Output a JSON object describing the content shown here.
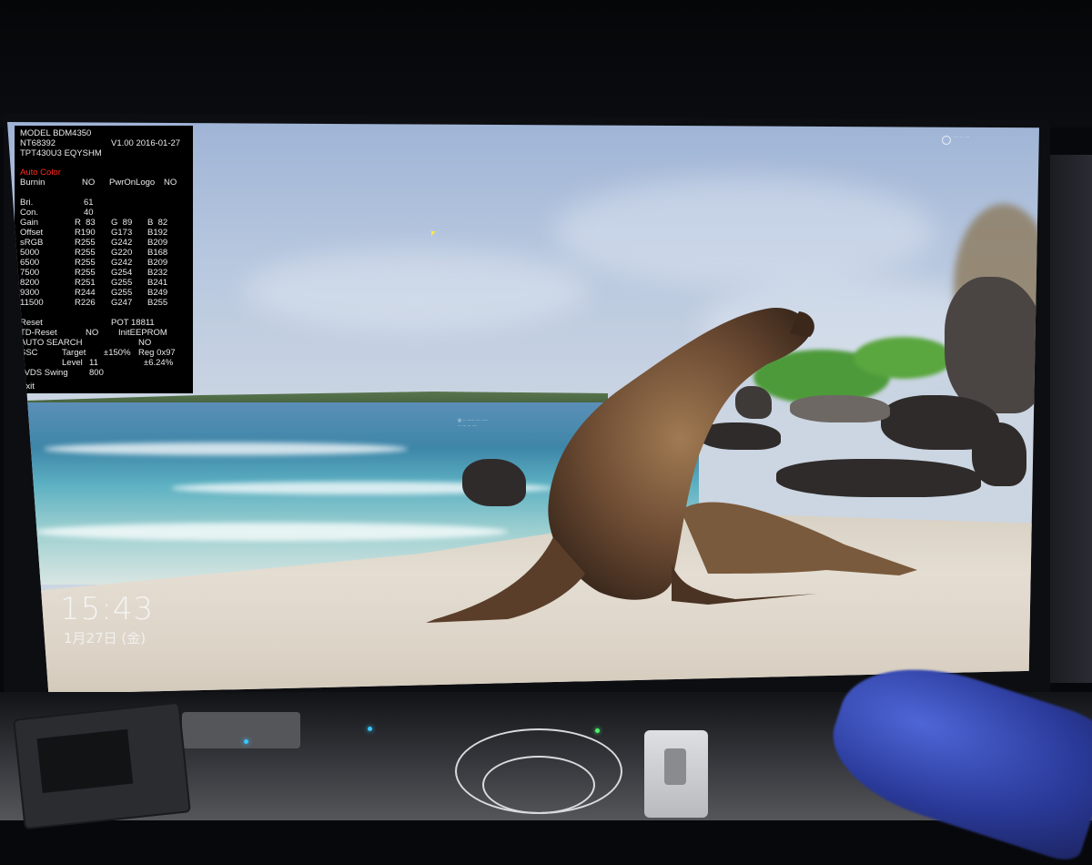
{
  "osd": {
    "model": "MODEL BDM4350",
    "chip": "NT68392",
    "version": "V1.00 2016-01-27",
    "panel": "TPT430U3 EQYSHM",
    "auto_color": "Auto Color",
    "burnin_label": "Burnin",
    "burnin_value": "NO",
    "pwr_label": "PwrOnLogo",
    "pwr_value": "NO",
    "bri_label": "Bri.",
    "bri_value": "61",
    "con_label": "Con.",
    "con_value": "40",
    "table": [
      {
        "label": "Gain",
        "r": "R  83",
        "g": "G  89",
        "b": "B  82"
      },
      {
        "label": "Offset",
        "r": "R190",
        "g": "G173",
        "b": "B192"
      },
      {
        "label": "sRGB",
        "r": "R255",
        "g": "G242",
        "b": "B209"
      },
      {
        "label": "5000",
        "r": "R255",
        "g": "G220",
        "b": "B168"
      },
      {
        "label": "6500",
        "r": "R255",
        "g": "G242",
        "b": "B209"
      },
      {
        "label": "7500",
        "r": "R255",
        "g": "G254",
        "b": "B232"
      },
      {
        "label": "8200",
        "r": "R251",
        "g": "G255",
        "b": "B241"
      },
      {
        "label": "9300",
        "r": "R244",
        "g": "G255",
        "b": "B249"
      },
      {
        "label": "11500",
        "r": "R226",
        "g": "G247",
        "b": "B255"
      }
    ],
    "reset_label": "Reset",
    "pot": "POT 18811",
    "tdreset_label": "TD-Reset",
    "tdreset_value": "NO",
    "initeeprom": "InitEEPROM",
    "autosearch_label": "AUTO SEARCH",
    "autosearch_value": "NO",
    "ssc_label": "SSC",
    "ssc_target": "Target",
    "ssc_target_value": "±150%",
    "ssc_reg": "Reg 0x97",
    "ssc_level": "Level",
    "ssc_level_value": "11",
    "ssc_pct": "±6.24%",
    "lvds_label": "LVDS Swing",
    "lvds_value": "800",
    "exit_label": "Exit"
  },
  "lockscreen": {
    "time": "15:43",
    "date": "1月27日 (金)"
  }
}
